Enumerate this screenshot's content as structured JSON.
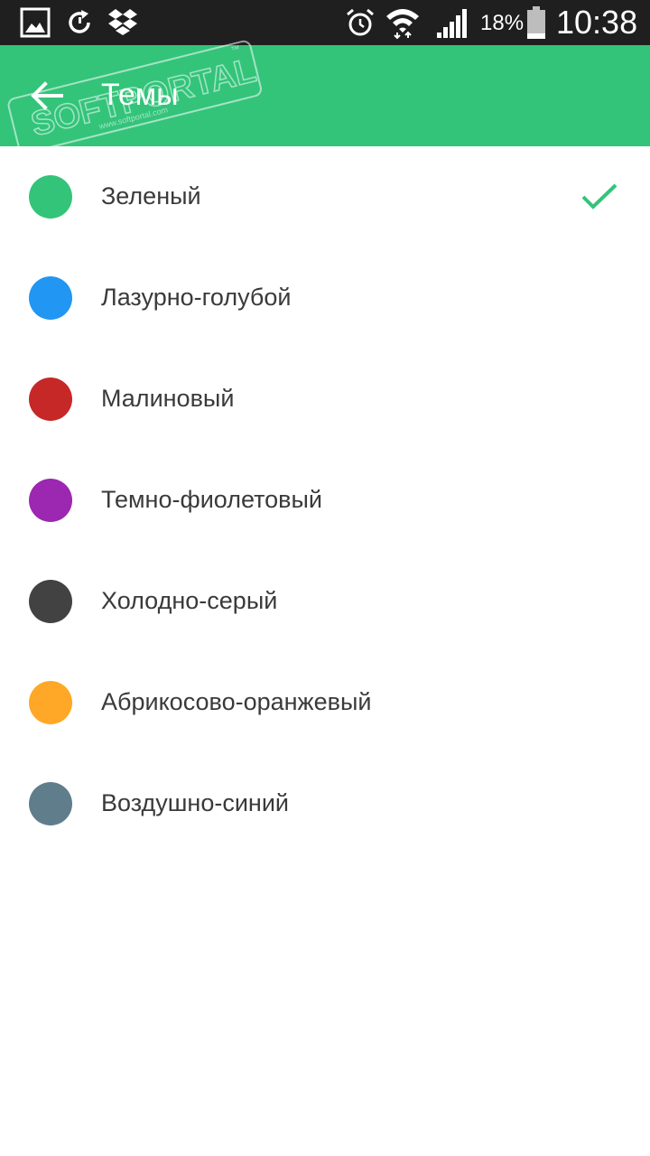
{
  "status_bar": {
    "battery_percent": "18%",
    "time": "10:38",
    "icons": [
      "gallery-icon",
      "sync-icon",
      "dropbox-icon",
      "alarm-icon",
      "wifi-icon",
      "signal-icon",
      "battery-icon"
    ]
  },
  "app_bar": {
    "title": "Темы",
    "back_icon": "arrow-back-icon",
    "background": "#33c47a"
  },
  "watermark": {
    "text": "SOFTPORTAL",
    "url": "www.softportal.com",
    "mark": "™"
  },
  "themes": [
    {
      "label": "Зеленый",
      "color": "#33c47a",
      "selected": true
    },
    {
      "label": "Лазурно-голубой",
      "color": "#2196f3",
      "selected": false
    },
    {
      "label": "Малиновый",
      "color": "#c62828",
      "selected": false
    },
    {
      "label": "Темно-фиолетовый",
      "color": "#9c27b0",
      "selected": false
    },
    {
      "label": "Холодно-серый",
      "color": "#424242",
      "selected": false
    },
    {
      "label": "Абрикосово-оранжевый",
      "color": "#ffa726",
      "selected": false
    },
    {
      "label": "Воздушно-синий",
      "color": "#607d8b",
      "selected": false
    }
  ],
  "check_color": "#33c47a"
}
